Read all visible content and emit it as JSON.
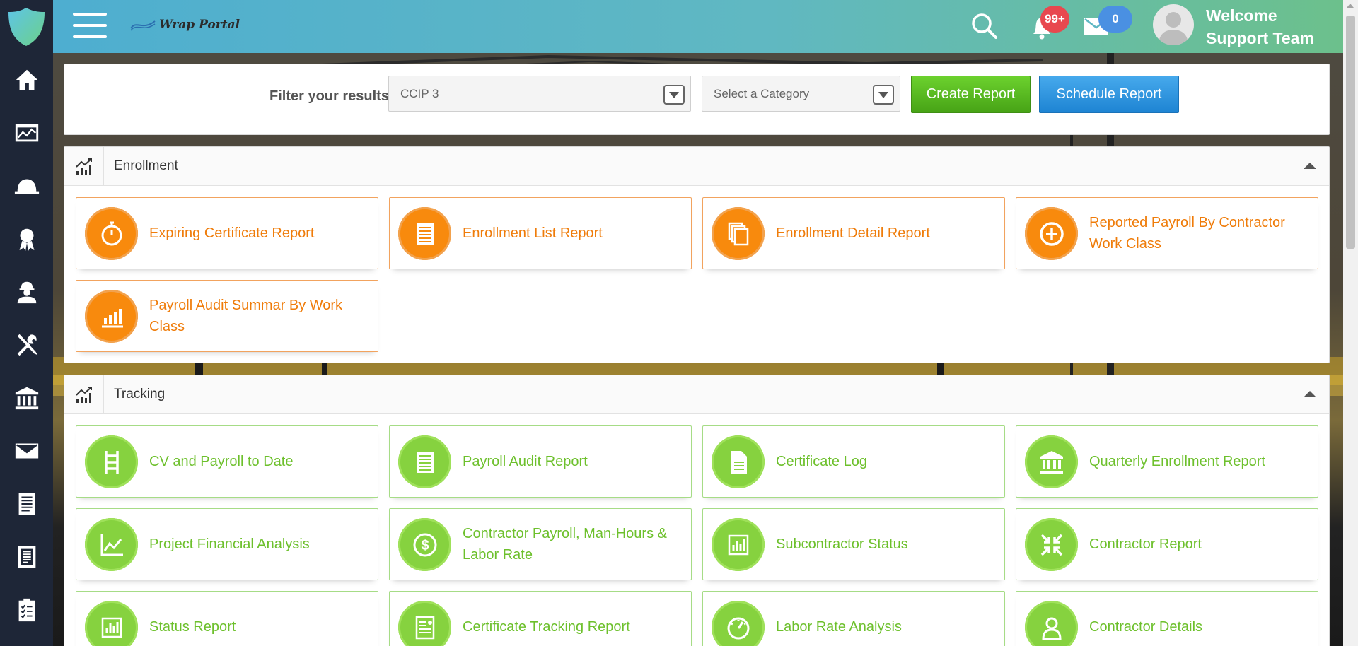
{
  "header": {
    "brand": "Wrap Portal",
    "notifications_count": "99+",
    "messages_count": "0",
    "welcome_line1": "Welcome",
    "welcome_line2": "Support Team"
  },
  "sidebar": {
    "items": [
      {
        "icon": "home-icon"
      },
      {
        "icon": "dashboard-chart-icon"
      },
      {
        "icon": "hard-hat-icon"
      },
      {
        "icon": "award-ribbon-icon"
      },
      {
        "icon": "worker-icon"
      },
      {
        "icon": "tools-icon"
      },
      {
        "icon": "bank-icon"
      },
      {
        "icon": "mail-icon"
      },
      {
        "icon": "document-icon"
      },
      {
        "icon": "report-page-icon"
      },
      {
        "icon": "clipboard-checklist-icon"
      }
    ]
  },
  "filter": {
    "label": "Filter your results",
    "project_value": "CCIP 3",
    "category_placeholder": "Select a Category",
    "create_label": "Create Report",
    "schedule_label": "Schedule Report"
  },
  "sections": {
    "enrollment": {
      "title": "Enrollment",
      "cards": [
        {
          "label": "Expiring Certificate Report",
          "icon": "stopwatch-icon"
        },
        {
          "label": "Enrollment List Report",
          "icon": "list-document-icon"
        },
        {
          "label": "Enrollment Detail Report",
          "icon": "stacked-documents-icon"
        },
        {
          "label": "Reported Payroll By Contractor Work Class",
          "icon": "plus-circle-icon"
        },
        {
          "label": "Payroll Audit Summar By Work Class",
          "icon": "bar-chart-icon"
        }
      ]
    },
    "tracking": {
      "title": "Tracking",
      "cards": [
        {
          "label": "CV and Payroll to Date",
          "icon": "ladder-icon"
        },
        {
          "label": "Payroll Audit Report",
          "icon": "list-document-icon"
        },
        {
          "label": "Certificate Log",
          "icon": "file-icon"
        },
        {
          "label": "Quarterly Enrollment Report",
          "icon": "bank-icon"
        },
        {
          "label": "Project Financial Analysis",
          "icon": "line-chart-icon"
        },
        {
          "label": "Contractor Payroll, Man-Hours & Labor Rate",
          "icon": "dollar-circle-icon"
        },
        {
          "label": "Subcontractor Status",
          "icon": "chart-frame-icon"
        },
        {
          "label": "Contractor Report",
          "icon": "compress-arrows-icon"
        },
        {
          "label": "Status Report",
          "icon": "chart-frame-icon"
        },
        {
          "label": "Certificate Tracking Report",
          "icon": "certificate-document-icon"
        },
        {
          "label": "Labor Rate Analysis",
          "icon": "gauge-icon"
        },
        {
          "label": "Contractor Details",
          "icon": "user-outline-icon"
        }
      ]
    }
  },
  "colors": {
    "enrollment_accent": "#f88a0d",
    "tracking_accent": "#86d23f",
    "create_button": "#47a316",
    "schedule_button": "#1e84d3",
    "rail_bg": "#1e2637"
  }
}
